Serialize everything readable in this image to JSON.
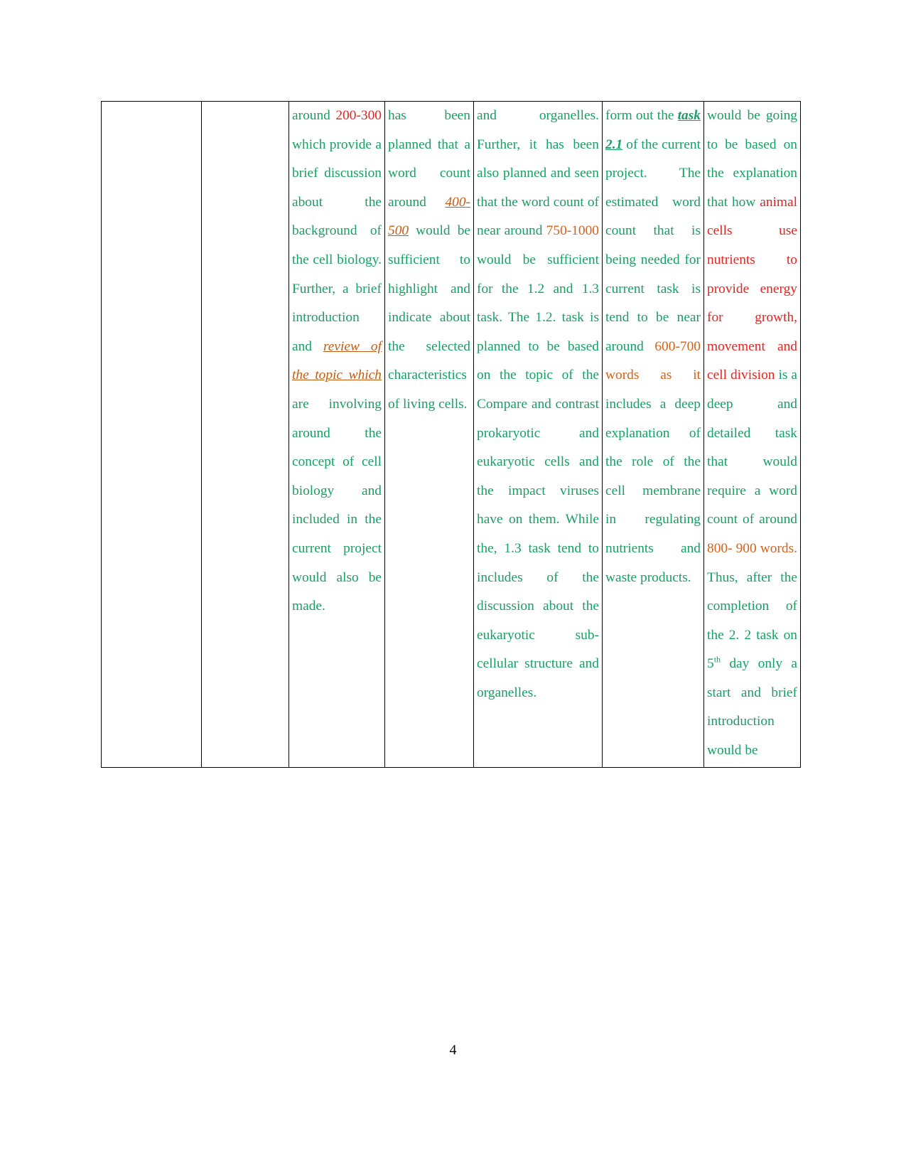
{
  "document": {
    "page_number": "4",
    "colors": {
      "body_text": "#17a063",
      "red_highlight": "#e8231f",
      "orange_highlight": "#d4621a",
      "orange_link": "#c55a11",
      "border": "#000000"
    }
  },
  "table": {
    "row": {
      "cell1": "",
      "cell2": "",
      "cell3": {
        "segments": [
          {
            "text": "around ",
            "style": "green"
          },
          {
            "text": "200-300",
            "style": "red"
          },
          {
            "text": " which provide a brief discussion about the background of the cell biology. Further, a brief introduction and ",
            "style": "green"
          },
          {
            "text": "review of the topic which",
            "style": "orange-italic-underline"
          },
          {
            "text": " are involving around the concept of cell biology and included in the current project would also be made.",
            "style": "green"
          }
        ],
        "plain": "around 200-300 which provide a brief discussion about the background of the cell biology. Further, a brief introduction and review of the topic which are involving around the concept of cell biology and included in the current project would also be made."
      },
      "cell4": {
        "segments": [
          {
            "text": "has been planned that a word count around ",
            "style": "green"
          },
          {
            "text": "400-500",
            "style": "orange-italic-underline"
          },
          {
            "text": " would be sufficient to highlight and indicate about the selected characteristics of living cells.",
            "style": "green"
          }
        ],
        "plain": "has been planned that a word count around 400-500 would be sufficient to highlight and indicate about the selected characteristics of living cells."
      },
      "cell5": {
        "segments": [
          {
            "text": "and organelles. Further, it has been also planned and seen that the word count of near around ",
            "style": "green"
          },
          {
            "text": "750-1000",
            "style": "orange"
          },
          {
            "text": " would be sufficient for the 1.2 and 1.3 task. The 1.2. task is planned to be based on the topic of the Compare and contrast prokaryotic and eukaryotic cells and the impact viruses have on them. While the, 1.3 task tend to includes of the discussion about the eukaryotic sub-cellular structure and organelles.",
            "style": "green"
          }
        ],
        "plain": "and organelles. Further, it has been also planned and seen that the word count of near around 750-1000 would be sufficient for the 1.2 and 1.3 task. The 1.2. task is planned to be based on the topic of the Compare and contrast prokaryotic and eukaryotic cells and the impact viruses have on them. While the, 1.3 task tend to includes of the discussion about the eukaryotic sub-cellular structure and organelles."
      },
      "cell6": {
        "segments": [
          {
            "text": "form out the ",
            "style": "green"
          },
          {
            "text": "task 2.1",
            "style": "green-bold-italic-underline"
          },
          {
            "text": " of the current project. The estimated word count that is being needed for current task is tend to be near around ",
            "style": "green"
          },
          {
            "text": "600-700 words as it",
            "style": "orange"
          },
          {
            "text": " includes a deep explanation of the role of the cell membrane in regulating nutrients and waste products.",
            "style": "green"
          }
        ],
        "plain": "form out the task 2.1 of the current project. The estimated word count that is being needed for current task is tend to be near around 600-700 words as it includes a deep explanation of the role of the cell membrane in regulating nutrients and waste products."
      },
      "cell7": {
        "segments": [
          {
            "text": "would be going to be based on the explanation that how ",
            "style": "green"
          },
          {
            "text": "animal cells use nutrients to provide energy for growth, movement and cell division",
            "style": "red"
          },
          {
            "text": " is a deep and detailed task that would require a word count of around ",
            "style": "green"
          },
          {
            "text": "800- 900 words.",
            "style": "orange"
          },
          {
            "text": " Thus, after the completion of the 2. 2 task on 5",
            "style": "green"
          },
          {
            "text": "th",
            "style": "green-superscript"
          },
          {
            "text": " day only a start and brief introduction would be",
            "style": "green"
          }
        ],
        "plain": "would be going to be based on the explanation that how animal cells use nutrients to provide energy for growth, movement and cell division is a deep and detailed task that would require a word count of around 800- 900 words. Thus, after the completion of the 2. 2 task on 5th day only a start and brief introduction would be"
      }
    }
  }
}
